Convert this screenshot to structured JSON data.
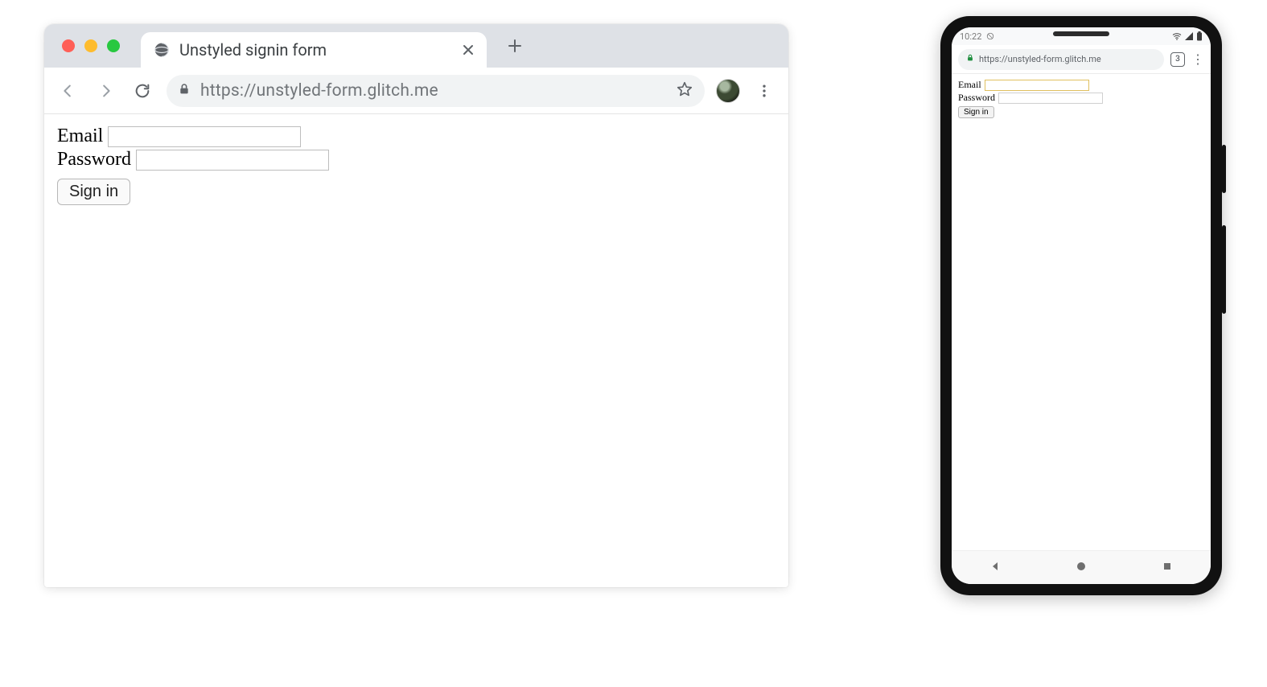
{
  "desktop": {
    "tab_title": "Unstyled signin form",
    "url": "https://unstyled-form.glitch.me",
    "form": {
      "email_label": "Email",
      "password_label": "Password",
      "submit_label": "Sign in"
    }
  },
  "mobile": {
    "status_time": "10:22",
    "url": "https://unstyled-form.glitch.me",
    "tab_count": "3",
    "form": {
      "email_label": "Email",
      "password_label": "Password",
      "submit_label": "Sign in"
    }
  }
}
